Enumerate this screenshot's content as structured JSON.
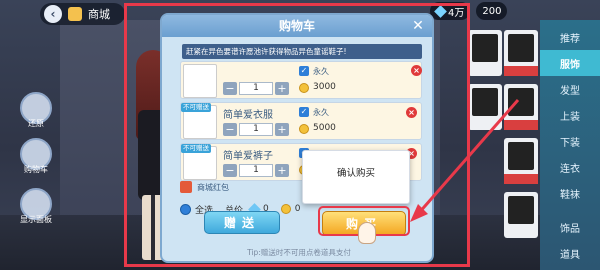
{
  "hud": {
    "title": "商城",
    "currency_a": "4万",
    "currency_b": "200"
  },
  "side_buttons": [
    "还原",
    "购物车",
    "显示面板"
  ],
  "categories": [
    "推荐",
    "服饰",
    "发型",
    "上装",
    "下装",
    "连衣",
    "鞋袜",
    "饰品",
    "道具"
  ],
  "dialog": {
    "title": "购物车",
    "close": "✕",
    "notice": "赶紧在异色要谱许愿池许获得物品异色童谣鞋子!",
    "items": [
      {
        "name": "",
        "tag": "",
        "check": "✓",
        "perm": "永久",
        "qty": "1",
        "price": "3000"
      },
      {
        "name": "简单爱衣服",
        "tag": "不可赠送",
        "check": "✓",
        "perm": "永久",
        "qty": "1",
        "price": "5000"
      },
      {
        "name": "简单爱裤子",
        "tag": "不可赠送",
        "check": "✓",
        "perm": "",
        "qty": "1",
        "price": ""
      }
    ],
    "bag_label": "商城红包",
    "select_all": "全选",
    "total_label": "总价",
    "total_gems": "0",
    "total_coins": "0",
    "gift_button": "赠送",
    "buy_button": "购买",
    "tip": "Tip:赠送时不可用点卷道具支付"
  },
  "confirm_popup": "确认购买",
  "colors": {
    "highlight_red": "#e8394a",
    "accent_blue": "#3aa3d9",
    "gold": "#f3c13a"
  }
}
